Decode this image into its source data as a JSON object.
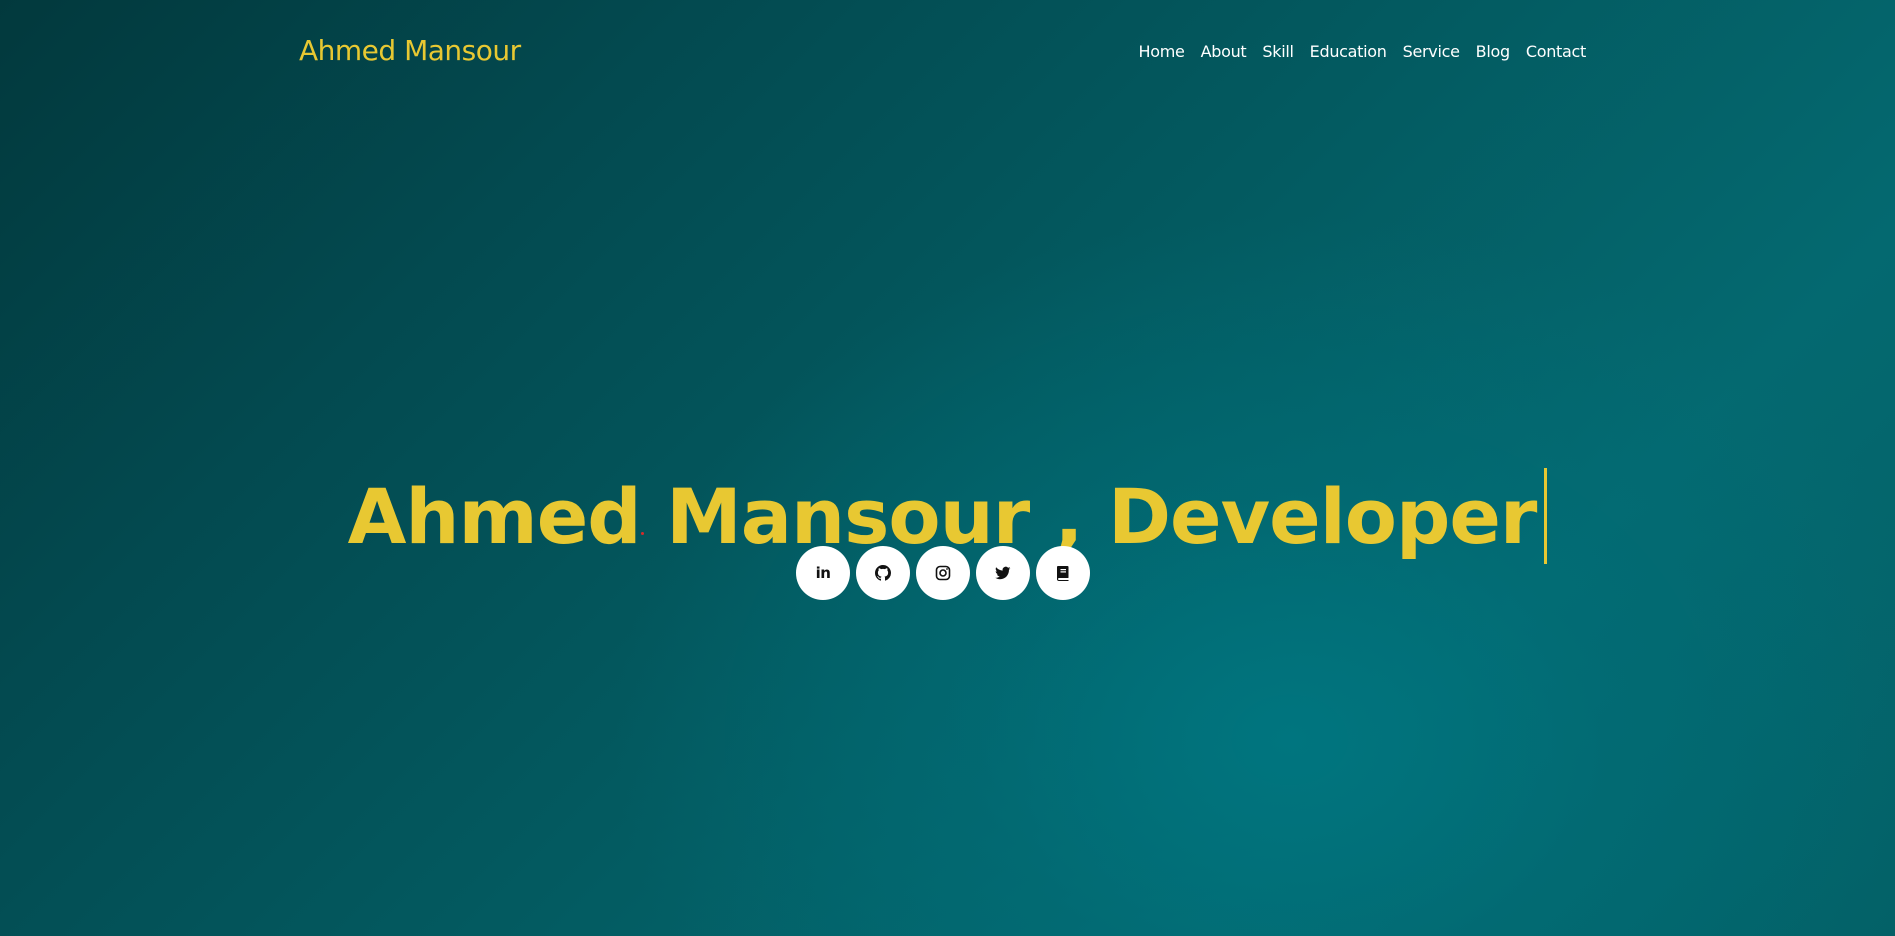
{
  "brand": {
    "name": "Ahmed Mansour",
    "color": "#e8c832"
  },
  "nav": {
    "items": [
      {
        "label": "Home"
      },
      {
        "label": "About"
      },
      {
        "label": "Skill"
      },
      {
        "label": "Education"
      },
      {
        "label": "Service"
      },
      {
        "label": "Blog"
      },
      {
        "label": "Contact"
      }
    ]
  },
  "hero": {
    "title": "Ahmed Mansour , Developer",
    "accent_color": "#e8c832"
  },
  "socials": [
    {
      "icon": "linkedin-icon",
      "label": "in"
    },
    {
      "icon": "github-icon"
    },
    {
      "icon": "instagram-icon"
    },
    {
      "icon": "twitter-icon"
    },
    {
      "icon": "book-icon"
    }
  ],
  "colors": {
    "background_dark": "#02393d",
    "background_light": "#00707a",
    "nav_text": "#ffffff"
  }
}
